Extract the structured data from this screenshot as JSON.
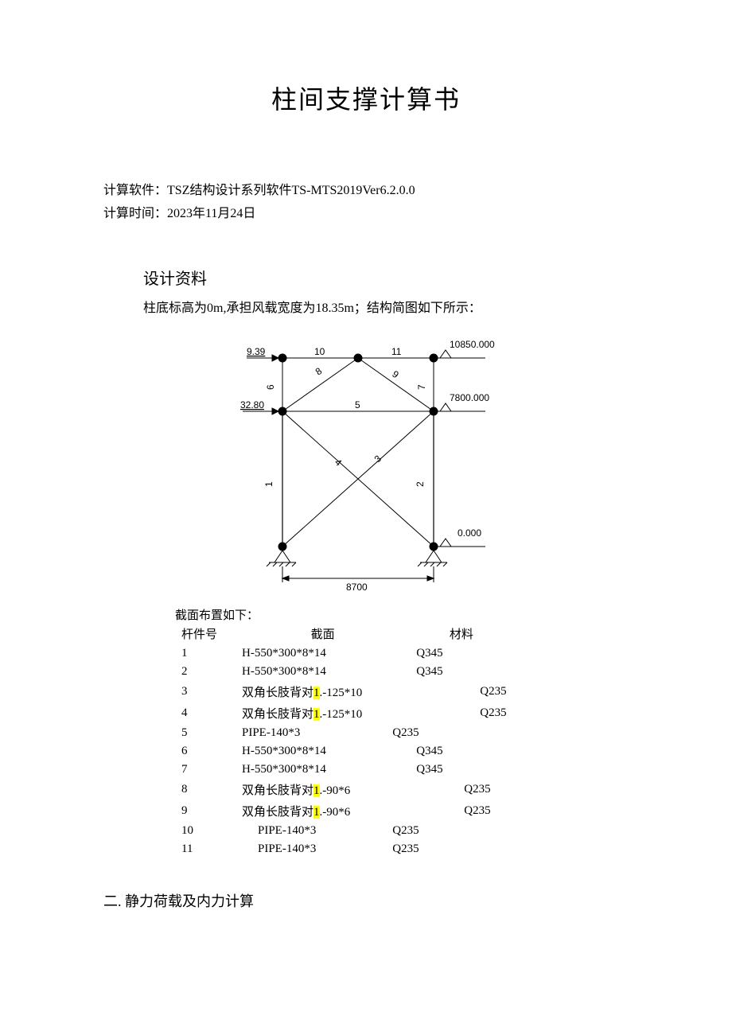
{
  "title": "柱间支撑计算书",
  "software_label": "计算软件：",
  "software": "TSZ结构设计系列软件TS-MTS2019Ver6.2.0.0",
  "time_label": "计算时间：",
  "time": "2023年11月24日",
  "section1_hdr": "设计资料",
  "intro_text": "柱底标高为0m,承担风载宽度为18.35m；结构简图如下所示：",
  "diagram": {
    "load_top": "9.39",
    "load_mid": "32.80",
    "elev_top": "10850.000",
    "elev_mid": "7800.000",
    "elev_bot": "0.000",
    "width": "8700",
    "member_labels": [
      "1",
      "2",
      "3",
      "4",
      "5",
      "6",
      "7",
      "8",
      "9",
      "10",
      "11"
    ]
  },
  "table_caption": "截面布置如下：",
  "th_id": "杆件号",
  "th_section": "截面",
  "th_material": "材料",
  "rows": [
    {
      "id": "1",
      "sec_pre": "H-550*300*8*14",
      "hl": "",
      "sec_post": "",
      "mat": "Q345",
      "indent": 0,
      "mat_off": 60
    },
    {
      "id": "2",
      "sec_pre": "H-550*300*8*14",
      "hl": "",
      "sec_post": "",
      "mat": "Q345",
      "indent": 0,
      "mat_off": 60
    },
    {
      "id": "3",
      "sec_pre": "双角长肢背对",
      "hl": "1",
      "sec_post": ".-125*10",
      "mat": "Q235",
      "indent": 0,
      "mat_off": 140
    },
    {
      "id": "4",
      "sec_pre": "双角长肢背对",
      "hl": "1",
      "sec_post": ".-125*10",
      "mat": "Q235",
      "indent": 0,
      "mat_off": 140
    },
    {
      "id": "5",
      "sec_pre": "PIPE-140*3",
      "hl": "",
      "sec_post": "",
      "mat": "Q235",
      "indent": 0,
      "mat_off": 30
    },
    {
      "id": "6",
      "sec_pre": "H-550*300*8*14",
      "hl": "",
      "sec_post": "",
      "mat": "Q345",
      "indent": 0,
      "mat_off": 60
    },
    {
      "id": "7",
      "sec_pre": "H-550*300*8*14",
      "hl": "",
      "sec_post": "",
      "mat": "Q345",
      "indent": 0,
      "mat_off": 60
    },
    {
      "id": "8",
      "sec_pre": "双角长肢背对",
      "hl": "1",
      "sec_post": ".-90*6",
      "mat": "Q235",
      "indent": 0,
      "mat_off": 120
    },
    {
      "id": "9",
      "sec_pre": "双角长肢背对",
      "hl": "1",
      "sec_post": ".-90*6",
      "mat": "Q235",
      "indent": 0,
      "mat_off": 120
    },
    {
      "id": "10",
      "sec_pre": "PIPE-140*3",
      "hl": "",
      "sec_post": "",
      "mat": "Q235",
      "indent": 20,
      "mat_off": 30
    },
    {
      "id": "11",
      "sec_pre": "PIPE-140*3",
      "hl": "",
      "sec_post": "",
      "mat": "Q235",
      "indent": 20,
      "mat_off": 30
    }
  ],
  "section2_hdr": "二. 静力荷载及内力计算"
}
